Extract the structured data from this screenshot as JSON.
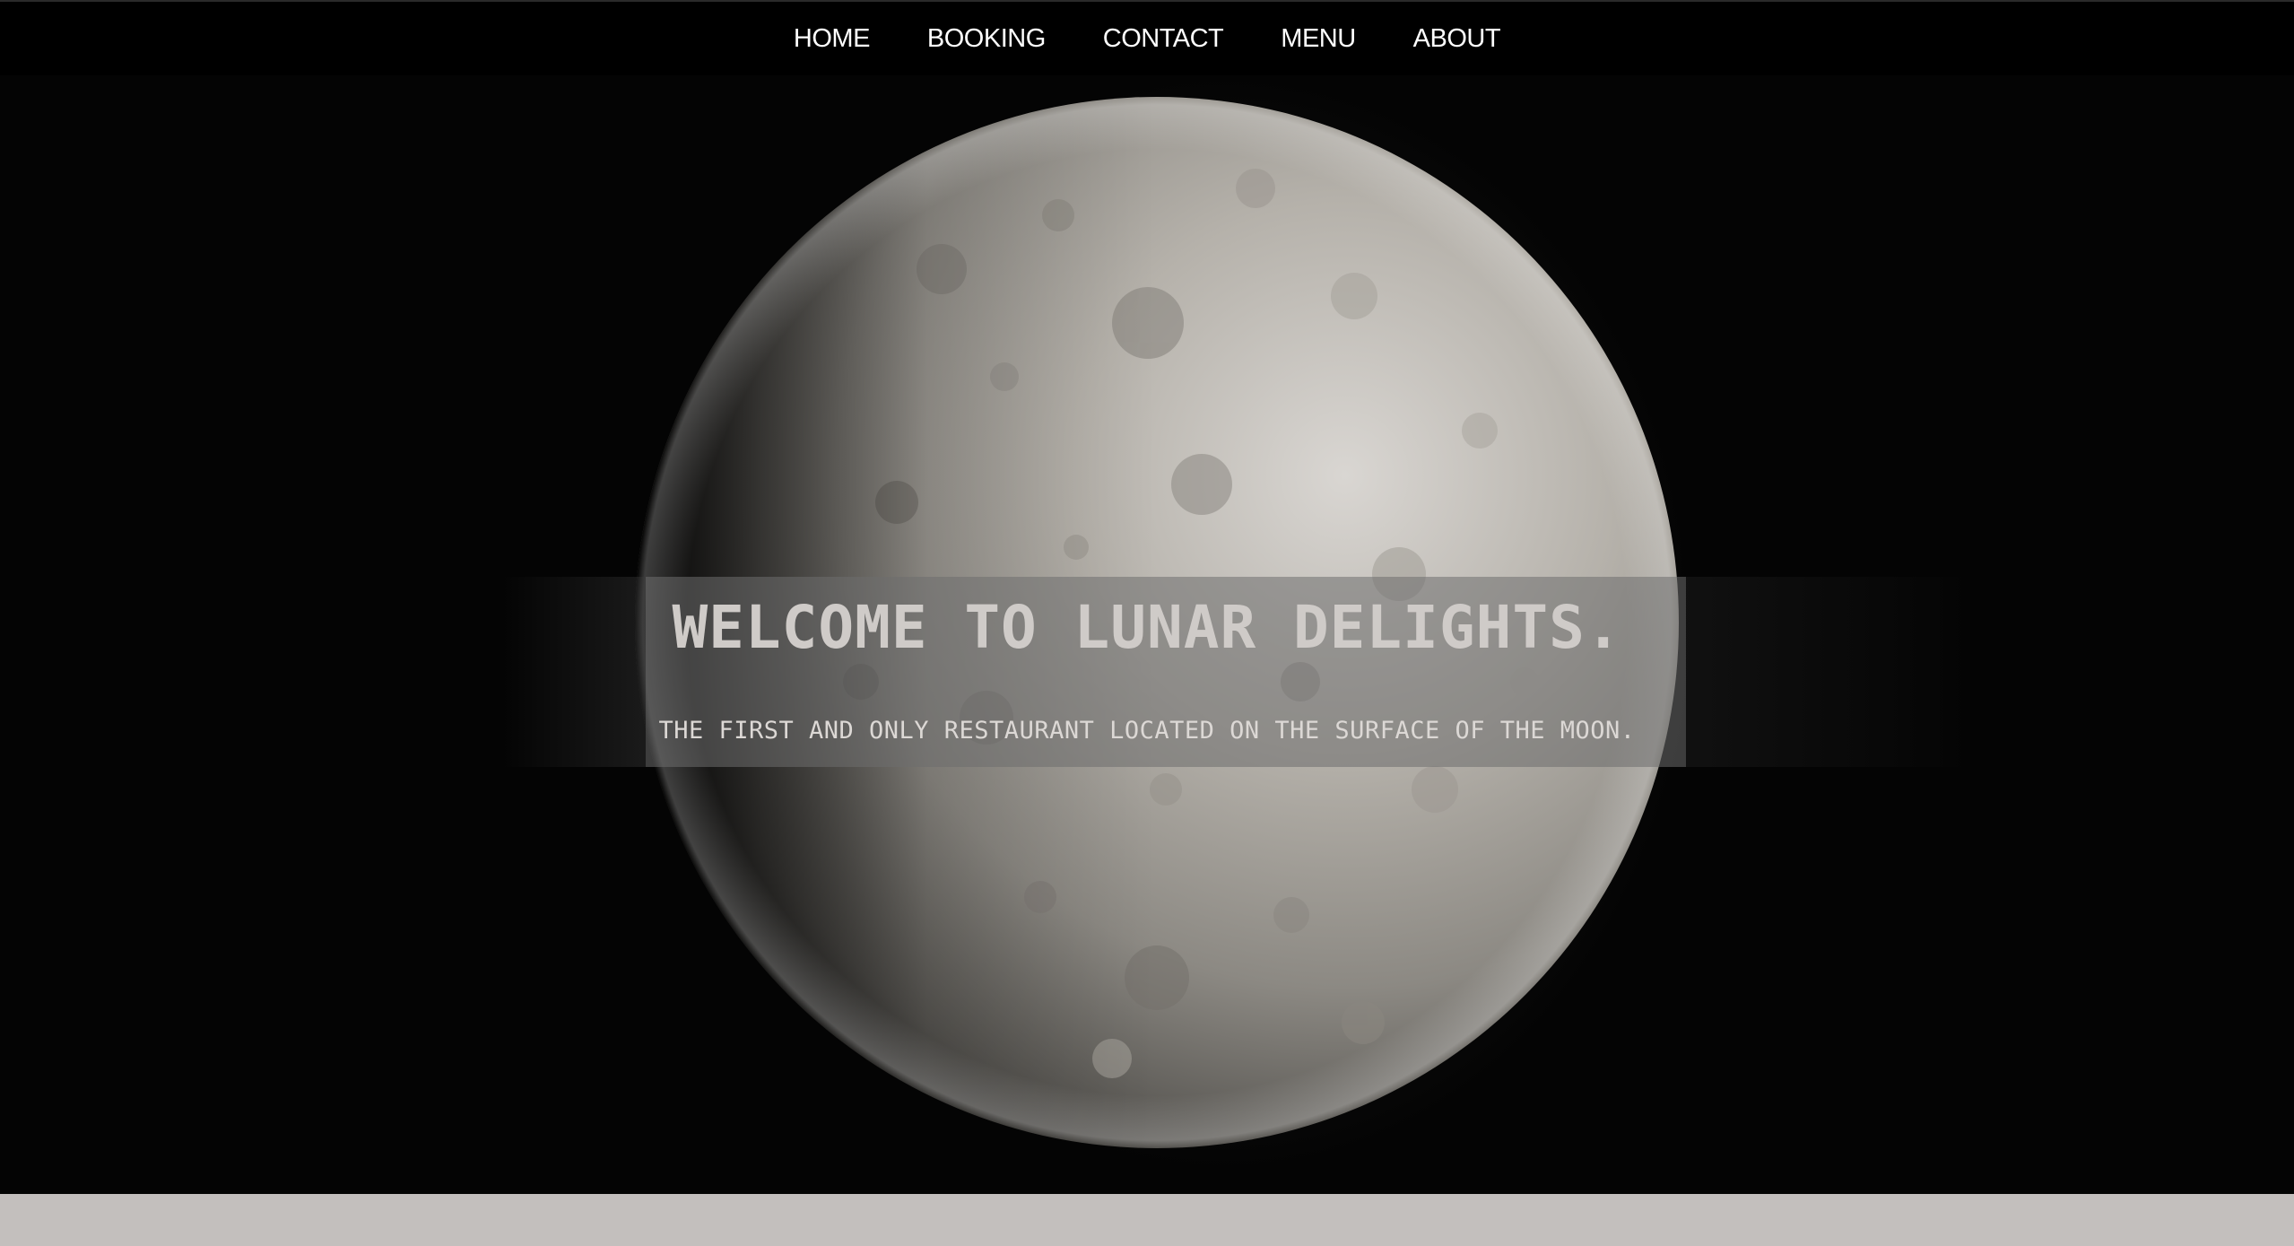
{
  "nav": {
    "items": [
      {
        "label": "HOME"
      },
      {
        "label": "BOOKING"
      },
      {
        "label": "CONTACT"
      },
      {
        "label": "MENU"
      },
      {
        "label": "ABOUT"
      }
    ]
  },
  "hero": {
    "title": "WELCOME TO LUNAR DELIGHTS.",
    "subtitle": "THE FIRST AND ONLY RESTAURANT LOCATED ON THE SURFACE OF THE MOON.",
    "background_image": "moon-photo"
  },
  "colors": {
    "nav_background": "#000000",
    "nav_text": "#ffffff",
    "hero_background": "#040404",
    "title_text": "#cfcbc8",
    "footer_band": "#c3bfbd"
  }
}
